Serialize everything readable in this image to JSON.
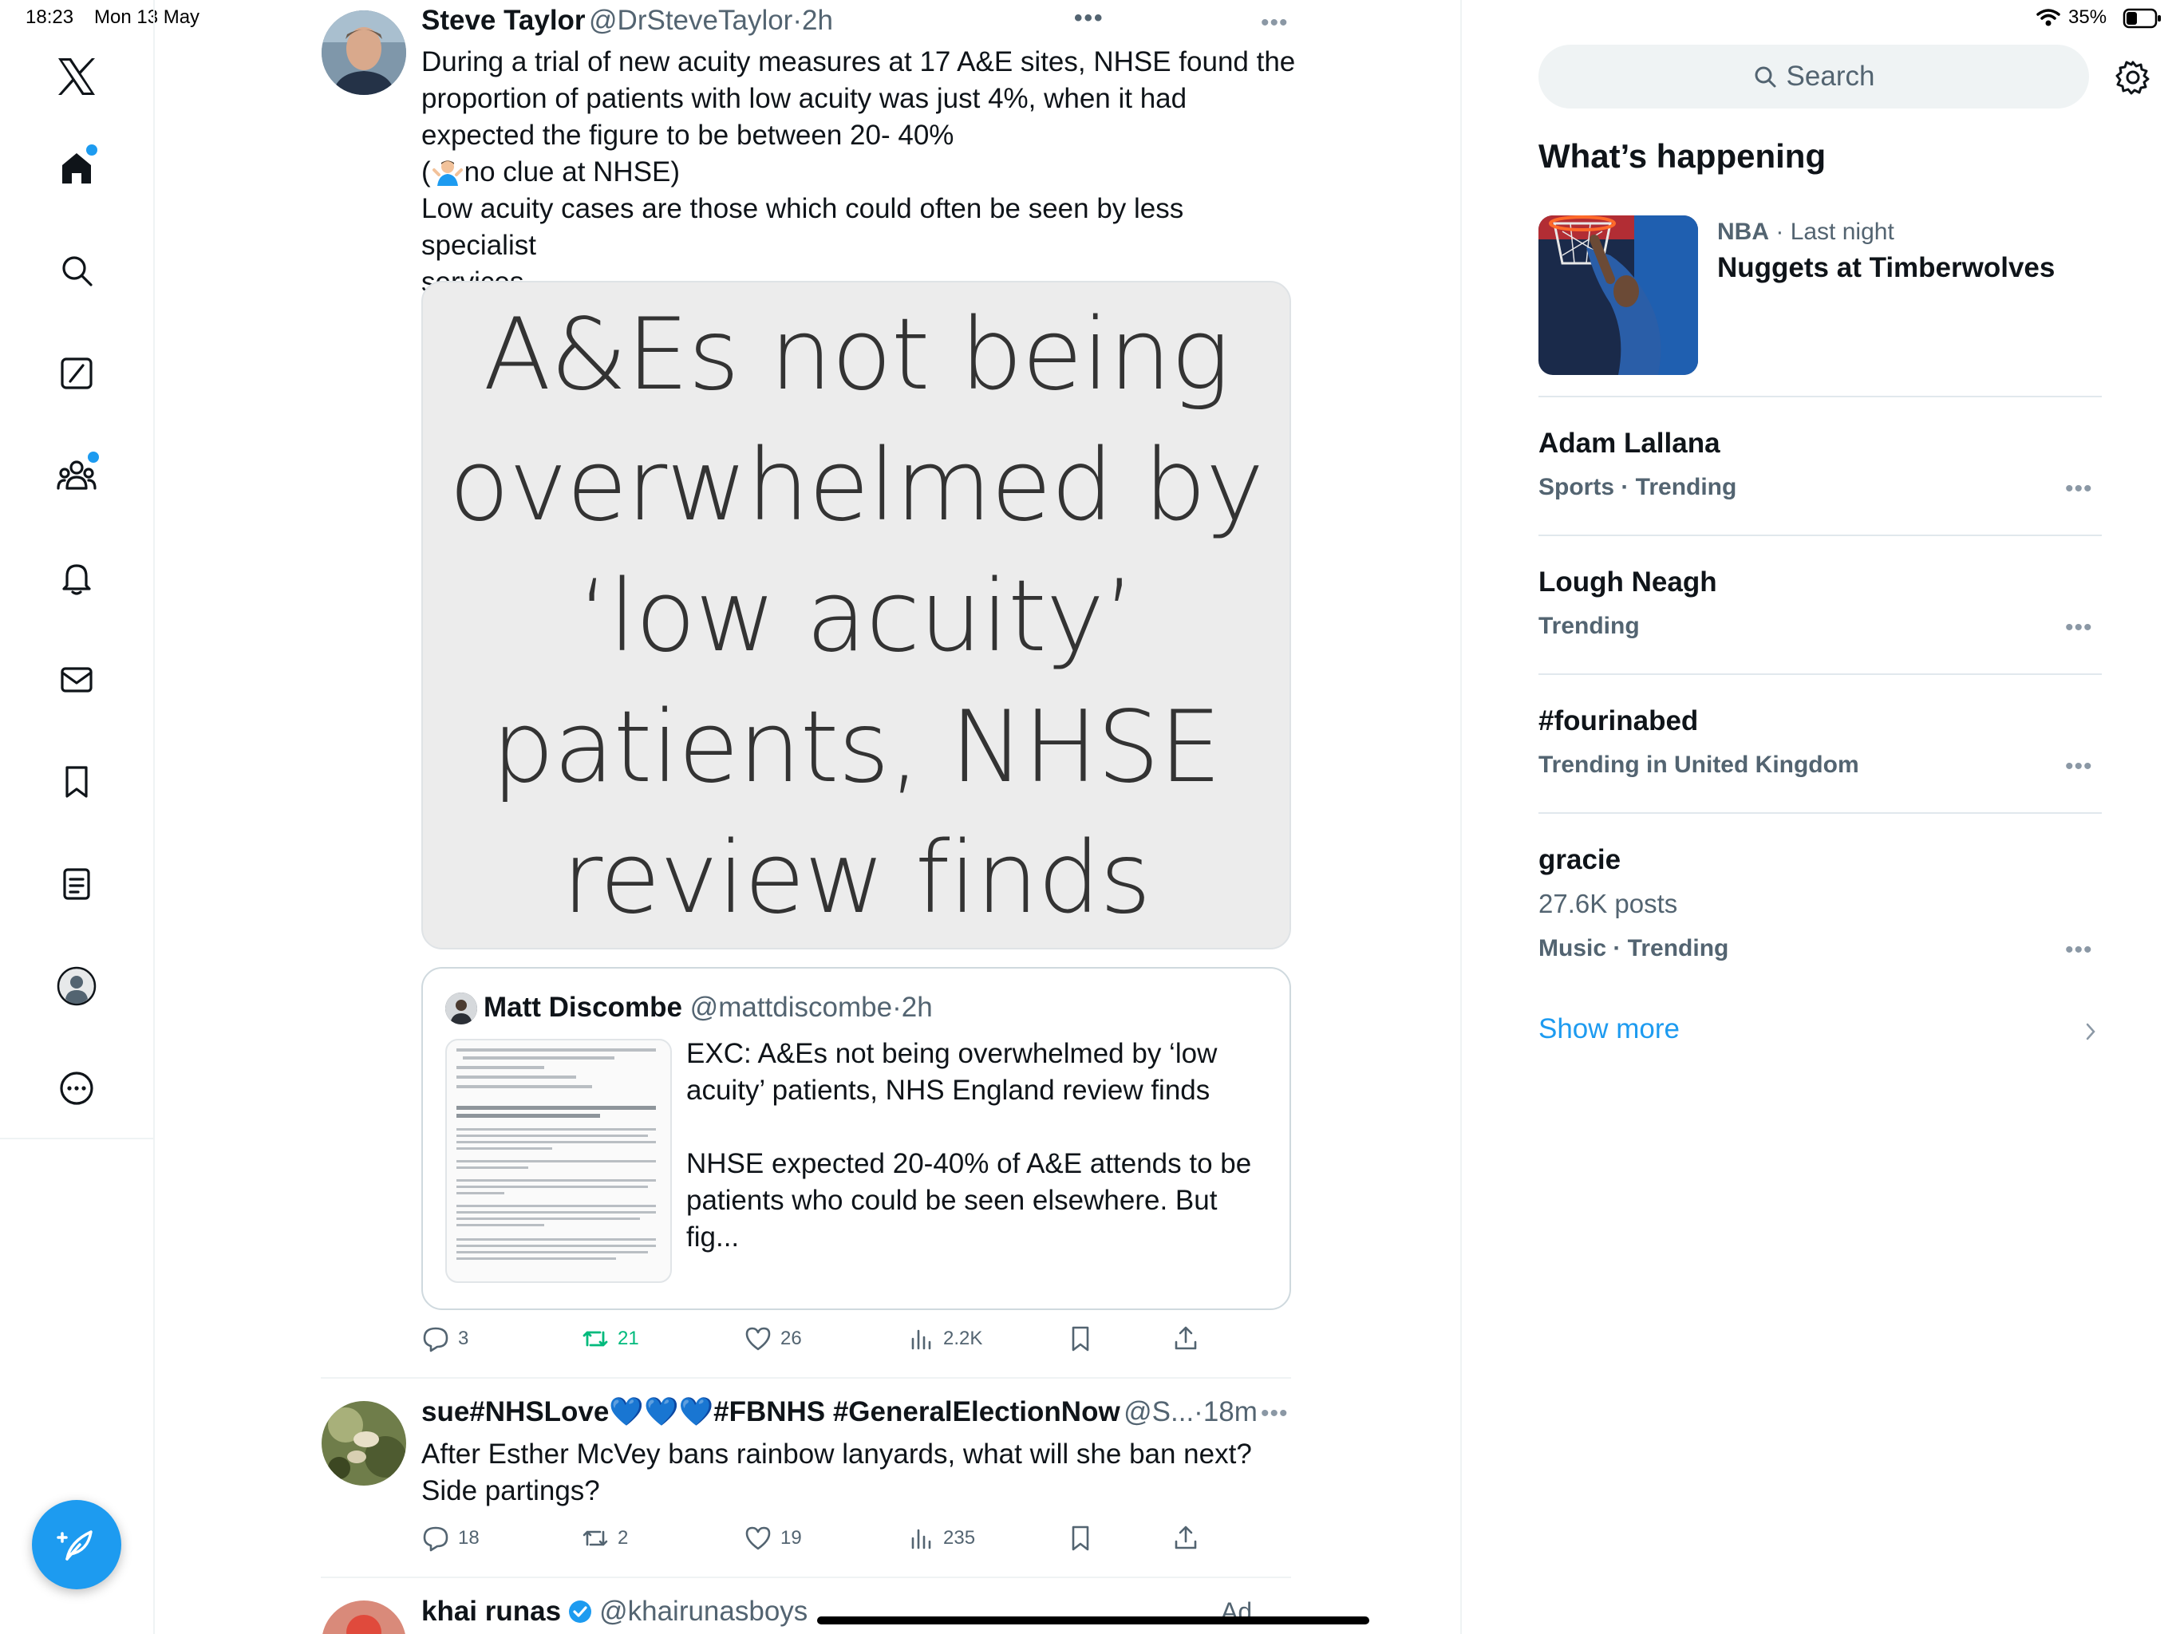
{
  "status_bar": {
    "time": "18:23",
    "date": "Mon 13 May",
    "battery": "35%"
  },
  "sidebar": {
    "logo": "x-logo-icon",
    "items": [
      {
        "name": "home",
        "icon": "home-icon",
        "badge": true
      },
      {
        "name": "explore",
        "icon": "search-icon",
        "badge": false
      },
      {
        "name": "grok",
        "icon": "grok-icon",
        "badge": false
      },
      {
        "name": "communities",
        "icon": "communities-icon",
        "badge": true
      },
      {
        "name": "notifications",
        "icon": "bell-icon",
        "badge": false
      },
      {
        "name": "messages",
        "icon": "mail-icon",
        "badge": false
      },
      {
        "name": "bookmarks",
        "icon": "bookmark-icon",
        "badge": false
      },
      {
        "name": "lists",
        "icon": "list-icon",
        "badge": false
      },
      {
        "name": "profile",
        "icon": "profile-icon",
        "badge": false
      },
      {
        "name": "more",
        "icon": "more-circle-icon",
        "badge": false
      }
    ],
    "compose_icon": "compose-feather-icon"
  },
  "feed": {
    "top_dots": "•••",
    "tweets": [
      {
        "name": "Steve Taylor",
        "handle": "@DrSteveTaylor",
        "time": "2h",
        "text_lines": [
          "During a trial of new acuity measures at 17 A&E sites, NHSE found the",
          "proportion of patients with low acuity was just 4%, when it had",
          "expected the figure to be between 20- 40%",
          "no clue at NHSE)",
          "Low acuity cases are those which could often be seen by less specialist",
          "services"
        ],
        "emoji_prefix": "(",
        "media_lines": [
          "A&Es not being",
          "overwhelmed by",
          "‘low acuity’",
          "patients, NHSE",
          "review finds"
        ],
        "quote": {
          "name": "Matt Discombe",
          "handle": "@mattdiscombe",
          "time": "2h",
          "text_lines": [
            "EXC: A&Es not being overwhelmed by ‘low",
            "acuity’ patients, NHS England review finds",
            "",
            "NHSE expected 20-40% of A&E attends to be",
            "patients who could be seen elsewhere. But fig..."
          ]
        },
        "stats": {
          "replies": "3",
          "retweets": "21",
          "likes": "26",
          "views": "2.2K"
        }
      },
      {
        "name": "sue#NHSLove💙💙💙#FBNHS #GeneralElectionNow",
        "handle": "@S...",
        "time": "18m",
        "text_lines": [
          "After Esther McVey bans rainbow lanyards, what will she  ban next?",
          "Side partings?"
        ],
        "stats": {
          "replies": "18",
          "retweets": "2",
          "likes": "19",
          "views": "235"
        }
      },
      {
        "name": "khai runas",
        "handle": "@khairunasboys",
        "ad_label": "Ad"
      }
    ]
  },
  "right": {
    "search_placeholder": "Search",
    "whats_happening": "What’s happening",
    "featured": {
      "category": "NBA",
      "time": "Last night",
      "title": "Nuggets at Timberwolves"
    },
    "trends": [
      {
        "title": "Adam Lallana",
        "meta": "Sports · Trending"
      },
      {
        "title": "Lough Neagh",
        "meta": "Trending"
      },
      {
        "title": "#fourinabed",
        "meta": "Trending in United Kingdom"
      },
      {
        "title": "gracie",
        "posts": "27.6K posts",
        "meta": "Music · Trending"
      }
    ],
    "show_more": "Show more"
  },
  "colors": {
    "accent": "#1d9bf0",
    "retweet_green": "#00ba7c",
    "muted": "#536471"
  }
}
